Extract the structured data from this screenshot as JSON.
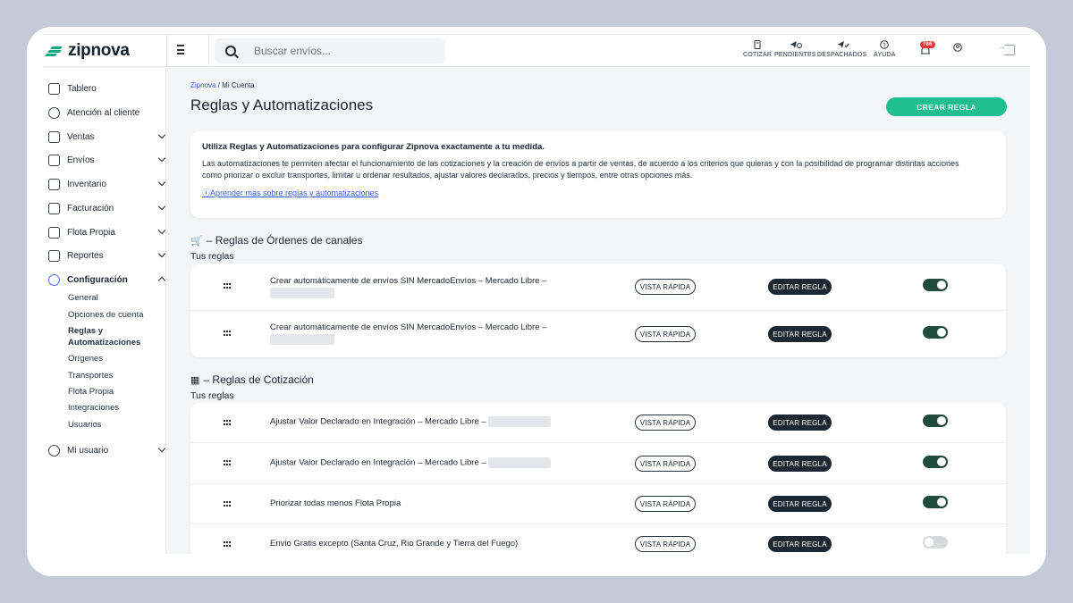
{
  "brand": {
    "name": "zipnova",
    "accent": "#16a884"
  },
  "search": {
    "placeholder": "Buscar envíos..."
  },
  "toolbar": [
    {
      "label": "COTIZAR",
      "icon": "calculator-icon"
    },
    {
      "label": "PENDIENTES",
      "icon": "paper-plane-clock-icon"
    },
    {
      "label": "DESPACHADOS",
      "icon": "paper-plane-check-icon"
    },
    {
      "label": "AYUDA",
      "icon": "help-icon"
    }
  ],
  "notifications": {
    "count": "786"
  },
  "sidebar": {
    "items": [
      {
        "label": "Tablero",
        "icon": "home-icon"
      },
      {
        "label": "Atención al cliente",
        "icon": "help-circle-icon"
      },
      {
        "label": "Ventas",
        "icon": "cart-icon"
      },
      {
        "label": "Envíos",
        "icon": "truck-icon"
      },
      {
        "label": "Inventario",
        "icon": "box-icon"
      },
      {
        "label": "Facturación",
        "icon": "money-icon"
      },
      {
        "label": "Flota Propia",
        "icon": "van-icon"
      },
      {
        "label": "Reportes",
        "icon": "chart-icon"
      },
      {
        "label": "Configuración",
        "icon": "gears-icon"
      },
      {
        "label": "Mi usuario",
        "icon": "user-gear-icon"
      }
    ],
    "config_sub": [
      "General",
      "Opciones de cuenta",
      "Reglas y Automatizaciones",
      "Orígenes",
      "Transportes",
      "Flota Propia",
      "Integraciones",
      "Usuarios"
    ]
  },
  "breadcrumb": {
    "root": "Zipnova",
    "separator": "/",
    "current": "Mi Cuenta"
  },
  "page": {
    "title": "Reglas y Automatizaciones",
    "create_label": "CREAR REGLA"
  },
  "info": {
    "title": "Utiliza Reglas y Automatizaciones para configurar Zipnova exactamente a tu medida.",
    "body": "Las automatizaciones te permiten afectar el funcionamiento de las cotizaciones y la creación de envíos a partir de ventas, de acuerdo a los criterios que quieras y con la posibilidad de programar distintas acciones como priorizar o excluir transportes, limitar u ordenar resultados, ajustar valores declarados, precios y tiempos, entre otras opciones más.",
    "link": "Aprender más sobre reglas y automatizaciones"
  },
  "sections": [
    {
      "title": "– Reglas de Órdenes de canales",
      "subtitle": "Tus reglas",
      "rules": [
        {
          "name": "Crear automáticamente de envíos SIN MercadoEnvíos – Mercado Libre –",
          "enabled": true
        },
        {
          "name": "Crear automáticamente de envíos SIN MercadoEnvíos – Mercado Libre –",
          "enabled": true
        }
      ]
    },
    {
      "title": "– Reglas de Cotización",
      "subtitle": "Tus reglas",
      "rules": [
        {
          "name": "Ajustar Valor Declarado en Integración – Mercado Libre –",
          "enabled": true
        },
        {
          "name": "Ajustar Valor Declarado en Integración – Mercado Libre –",
          "enabled": true
        },
        {
          "name": "Priorizar todas menos Flota Propia",
          "enabled": true
        },
        {
          "name": "Envio Gratis excepto (Santa Cruz, Rio Grande y Tierra del Fuego)",
          "enabled": false
        }
      ]
    }
  ],
  "buttons": {
    "quick": "VISTA RÁPIDA",
    "edit": "EDITAR REGLA"
  }
}
